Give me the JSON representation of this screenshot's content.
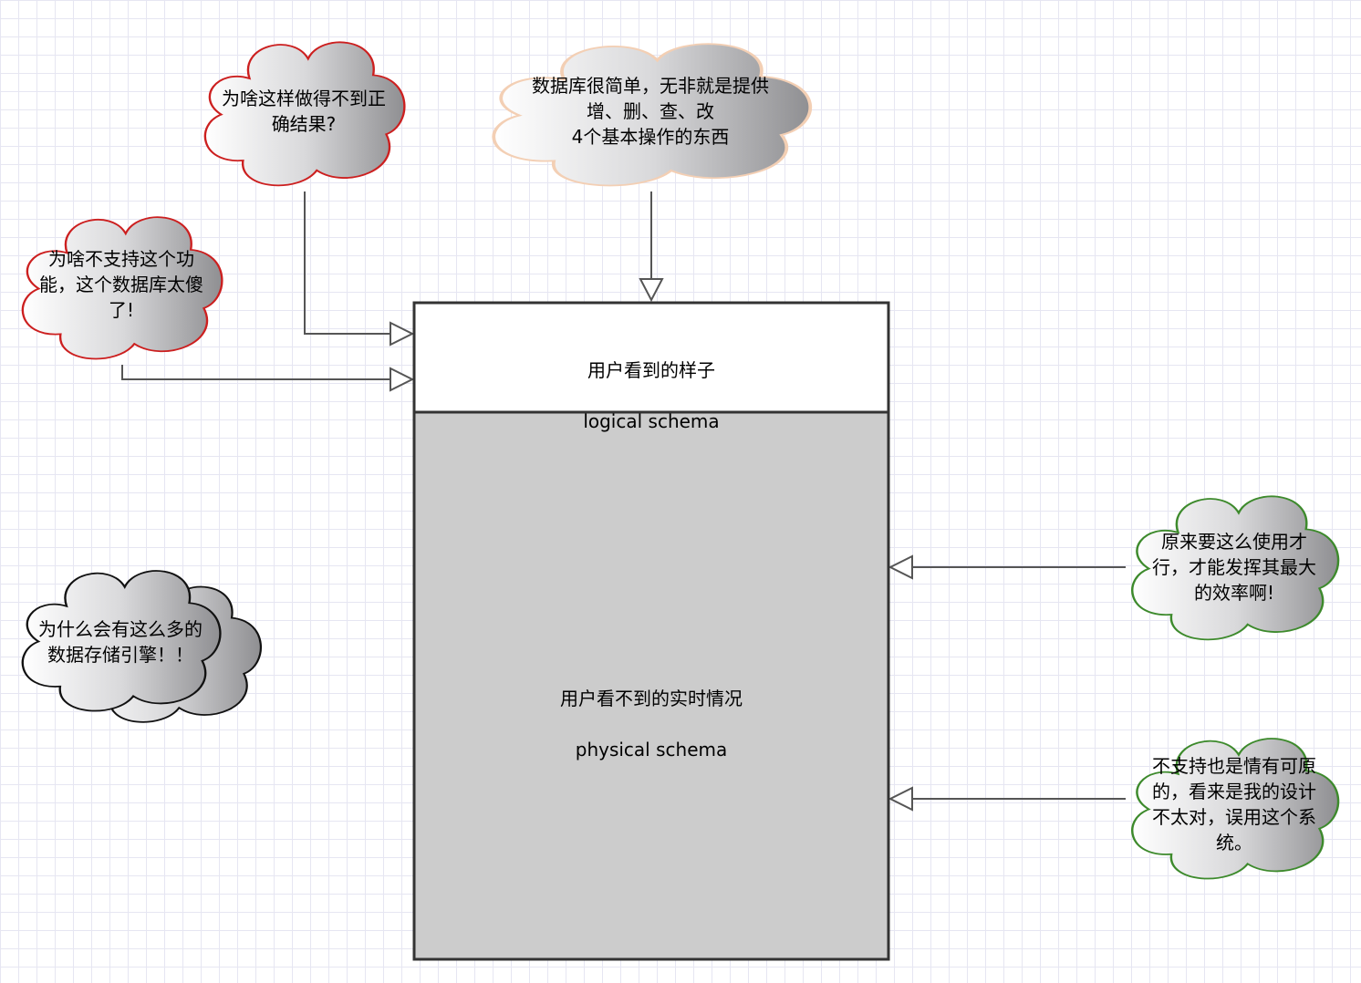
{
  "colors": {
    "grid": "#e6e6f2",
    "red_outline": "#cc1f1f",
    "green_outline": "#3d8a2c",
    "peach_outline": "#f3cfb4",
    "black_outline": "#111111",
    "physical_fill": "#cccccc",
    "connector": "#555555"
  },
  "schema_box": {
    "logical": {
      "line1": "用户看到的样子",
      "line2": "logical schema"
    },
    "physical": {
      "line1": "用户看不到的实时情况",
      "line2": "physical schema"
    }
  },
  "clouds": {
    "why_not_correct": "为啥这样做得不到正\n确结果?",
    "why_not_supported": "为啥不支持这个功\n能，这个数据库太傻\n了!",
    "db_simple": "数据库很简单，无非就是提供\n增、删、查、改\n4个基本操作的东西",
    "why_many_engines": "为什么会有这么多的\n数据存储引擎！！",
    "use_this_way": "原来要这么使用才\n行，才能发挥其最大\n的效率啊!",
    "understandable": "不支持也是情有可原\n的，看来是我的设计\n不太对，误用这个系\n统。"
  }
}
